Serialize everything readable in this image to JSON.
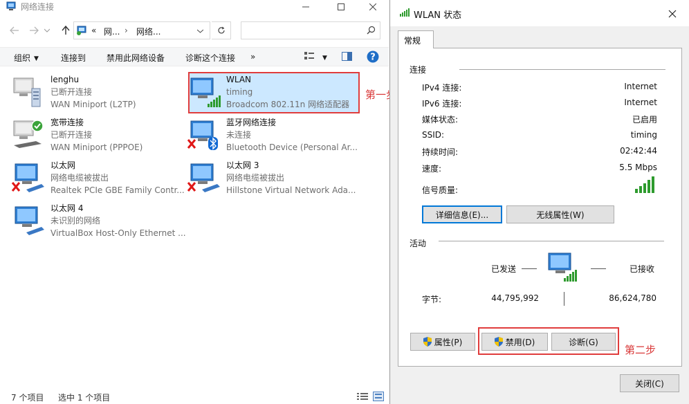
{
  "explorer": {
    "title": "网络连接",
    "breadcrumb": {
      "overflow": "«",
      "part1": "网...",
      "part2": "网络..."
    },
    "search_placeholder": "",
    "commands": [
      "组织",
      "连接到",
      "禁用此网络设备",
      "诊断这个连接",
      "»"
    ],
    "items": [
      {
        "name": "lenghu",
        "status": "已断开连接",
        "device": "WAN Miniport (L2TP)"
      },
      {
        "name": "WLAN",
        "status": "timing",
        "device": "Broadcom 802.11n 网络适配器"
      },
      {
        "name": "宽带连接",
        "status": "已断开连接",
        "device": "WAN Miniport (PPPOE)"
      },
      {
        "name": "蓝牙网络连接",
        "status": "未连接",
        "device": "Bluetooth Device (Personal Ar..."
      },
      {
        "name": "以太网",
        "status": "网络电缆被拔出",
        "device": "Realtek PCIe GBE Family Contr..."
      },
      {
        "name": "以太网 3",
        "status": "网络电缆被拔出",
        "device": "Hillstone Virtual Network Ada..."
      },
      {
        "name": "以太网 4",
        "status": "未识别的网络",
        "device": "VirtualBox Host-Only Ethernet ..."
      }
    ],
    "step1_label": "第一步",
    "status_count": "7 个项目",
    "status_selected": "选中 1 个项目"
  },
  "dialog": {
    "title": "WLAN 状态",
    "tab": "常规",
    "connection_section": "连接",
    "fields": [
      {
        "label": "IPv4 连接:",
        "value": "Internet"
      },
      {
        "label": "IPv6 连接:",
        "value": "Internet"
      },
      {
        "label": "媒体状态:",
        "value": "已启用"
      },
      {
        "label": "SSID:",
        "value": "timing"
      },
      {
        "label": "持续时间:",
        "value": "02:42:44"
      },
      {
        "label": "速度:",
        "value": "5.5 Mbps"
      }
    ],
    "signal_label": "信号质量:",
    "details_button": "详细信息(E)...",
    "wireless_props_button": "无线属性(W)",
    "activity_section": "活动",
    "sent_label": "已发送",
    "received_label": "已接收",
    "bytes_label": "字节:",
    "bytes_sent": "44,795,992",
    "bytes_received": "86,624,780",
    "properties_button": "属性(P)",
    "disable_button": "禁用(D)",
    "diagnose_button": "诊断(G)",
    "step2_label": "第二步",
    "close_button": "关闭(C)"
  },
  "colors": {
    "selection": "#cce8ff",
    "annotation_red": "#e03c3c",
    "signal_green": "#2e9b2e",
    "monitor_blue": "#2f7fd3"
  }
}
